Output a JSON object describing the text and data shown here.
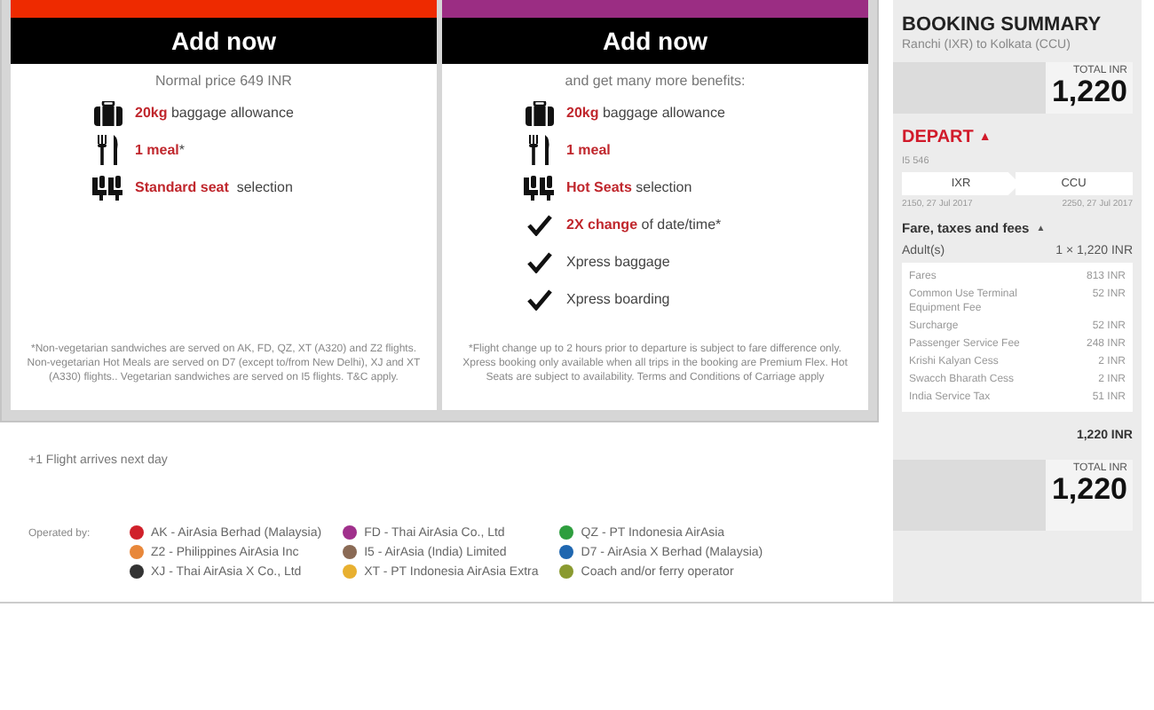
{
  "cards": [
    {
      "color": "#ee2a00",
      "button": "Add now",
      "subtitle": "Normal price 649 INR",
      "features": [
        {
          "kind": "bag",
          "text": "**20kg** baggage allowance"
        },
        {
          "kind": "meal",
          "text": "**1 meal***"
        },
        {
          "kind": "seat",
          "text": "**Standard seat**  selection"
        }
      ],
      "footnote": "*Non-vegetarian sandwiches are served on AK, FD, QZ, XT (A320) and Z2 flights. Non-vegetarian Hot Meals are served on D7 (except to/from New Delhi), XJ and XT (A330) flights.. Vegetarian sandwiches are served on I5 flights. T&C apply."
    },
    {
      "color": "#9b2d83",
      "button": "Add now",
      "subtitle": "and get many more benefits:",
      "features": [
        {
          "kind": "bag",
          "text": "**20kg** baggage allowance"
        },
        {
          "kind": "meal",
          "text": "**1 meal**"
        },
        {
          "kind": "seat",
          "text": "**Hot Seats** selection"
        },
        {
          "kind": "check",
          "text": "**2X change** of date/time*"
        },
        {
          "kind": "check",
          "text": "Xpress baggage"
        },
        {
          "kind": "check",
          "text": "Xpress boarding"
        }
      ],
      "footnote": "*Flight change up to 2 hours prior to departure is subject to fare difference only. Xpress booking only available when all trips in the booking are Premium Flex. Hot Seats are subject to availability. Terms and Conditions of Carriage apply"
    }
  ],
  "next_day_note": "+1 Flight arrives next day",
  "operators": {
    "label": "Operated by:",
    "items": [
      {
        "text": "AK - AirAsia Berhad (Malaysia)",
        "color": "#d0202a"
      },
      {
        "text": "FD - Thai AirAsia Co., Ltd",
        "color": "#a0308c"
      },
      {
        "text": "QZ - PT Indonesia AirAsia",
        "color": "#2e9e3e"
      },
      {
        "text": "Z2 - Philippines AirAsia Inc",
        "color": "#e8873a"
      },
      {
        "text": "I5 - AirAsia (India) Limited",
        "color": "#8a6a55"
      },
      {
        "text": "D7 - AirAsia X Berhad (Malaysia)",
        "color": "#1f67b0"
      },
      {
        "text": "XJ - Thai AirAsia X Co., Ltd",
        "color": "#333333"
      },
      {
        "text": "XT - PT Indonesia AirAsia Extra",
        "color": "#e8b030"
      },
      {
        "text": "Coach and/or ferry operator",
        "color": "#8a9a30"
      }
    ]
  },
  "summary": {
    "title": "BOOKING SUMMARY",
    "route": "Ranchi (IXR) to Kolkata (CCU)",
    "total_top": {
      "label": "TOTAL INR",
      "amount": "1,220"
    },
    "depart": {
      "label": "DEPART",
      "arrow": "▲",
      "expanded": true
    },
    "flight": "I5 546",
    "from": {
      "code": "IXR",
      "time": "2150, 27 Jul 2017"
    },
    "to": {
      "code": "CCU",
      "time": "2250, 27 Jul 2017"
    },
    "fare_heading": "Fare, taxes and fees",
    "fare_arrow": "▲",
    "passenger": {
      "label": "Adult(s)",
      "value": "1 × 1,220 INR"
    },
    "breakdown": [
      {
        "name": "Fares",
        "amount": "813 INR"
      },
      {
        "name": "Common Use Terminal Equipment Fee",
        "amount": "52 INR"
      },
      {
        "name": "Surcharge",
        "amount": "52 INR"
      },
      {
        "name": "Passenger Service Fee",
        "amount": "248 INR"
      },
      {
        "name": "Krishi Kalyan Cess",
        "amount": "2 INR"
      },
      {
        "name": "Swacch Bharath Cess",
        "amount": "2 INR"
      },
      {
        "name": "India Service Tax",
        "amount": "51 INR"
      }
    ],
    "subtotal": "1,220 INR",
    "total_bottom": {
      "label": "TOTAL INR",
      "amount": "1,220"
    }
  }
}
